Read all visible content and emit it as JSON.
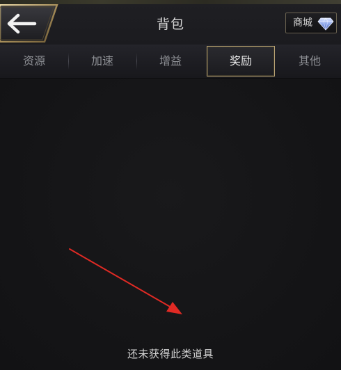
{
  "header": {
    "title": "背包",
    "shop_label": "商城"
  },
  "tabs": [
    {
      "label": "资源",
      "active": false
    },
    {
      "label": "加速",
      "active": false
    },
    {
      "label": "增益",
      "active": false
    },
    {
      "label": "奖励",
      "active": true
    },
    {
      "label": "其他",
      "active": false
    }
  ],
  "content": {
    "empty_message": "还未获得此类道具"
  },
  "colors": {
    "accent_gold": "#b9a374",
    "annotation_red": "#e02a24",
    "text_light": "#d6d6d6",
    "text_muted": "#8f9196"
  },
  "icons": {
    "back": "back-arrow-icon",
    "shop": "diamond-icon"
  }
}
